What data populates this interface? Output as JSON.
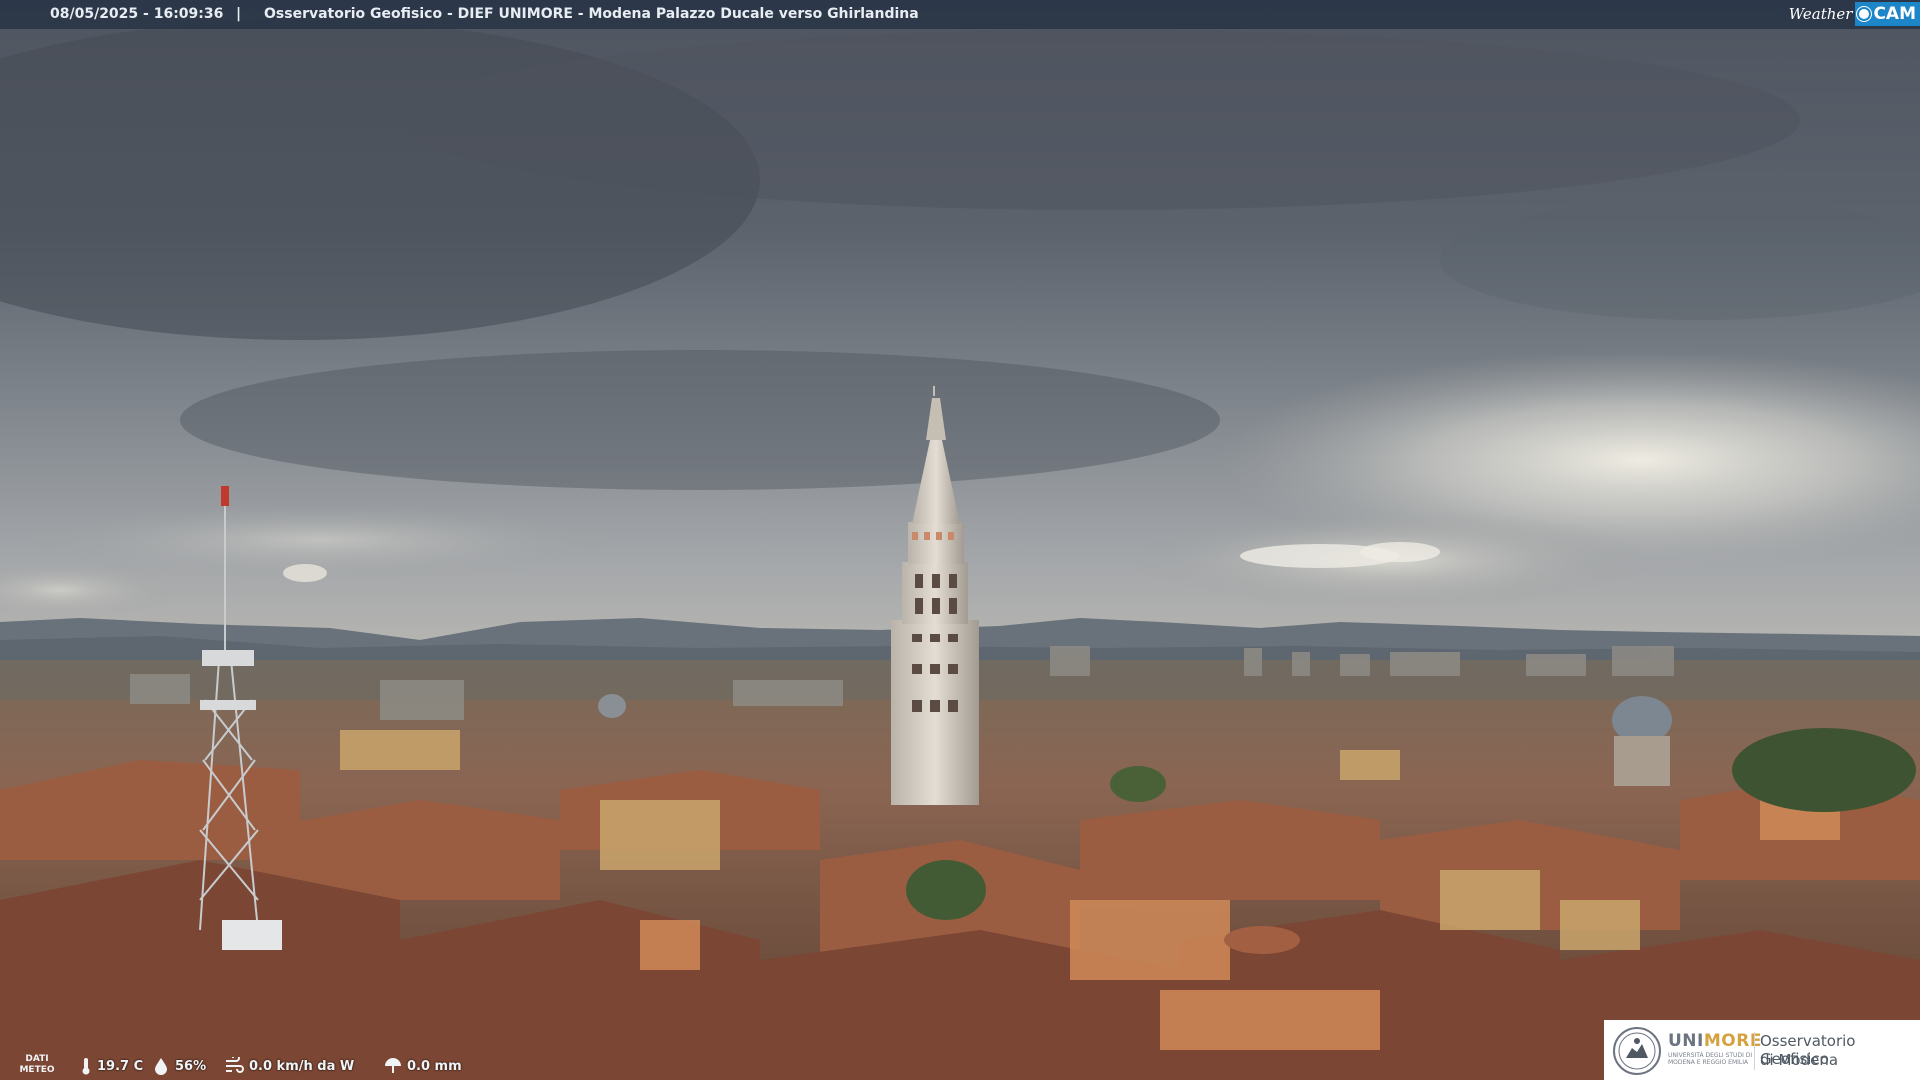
{
  "header": {
    "datetime": "08/05/2025 - 16:09:36",
    "separator": "|",
    "title": "Osservatorio Geofisico - DIEF UNIMORE - Modena Palazzo Ducale verso Ghirlandina"
  },
  "webcam_logo": {
    "word1": "Weather",
    "word2": "CAM",
    "accent_color": "#1c86c9"
  },
  "meteo": {
    "label_line1": "DATI",
    "label_line2": "METEO",
    "temperature": "19.7 C",
    "humidity": "56%",
    "wind": "0.0 km/h da W",
    "rain": "0.0 mm",
    "icons": [
      "thermometer-icon",
      "humidity-drop-icon",
      "wind-icon",
      "rain-icon"
    ]
  },
  "org_logo": {
    "name_part1": "UNI",
    "name_part2": "MORE",
    "subtitle": "UNIVERSITÀ DEGLI STUDI DI MODENA E REGGIO EMILIA",
    "org_line1": "Osservatorio Geofisico",
    "org_line2": "di Modena",
    "accent_color": "#d4a340"
  }
}
